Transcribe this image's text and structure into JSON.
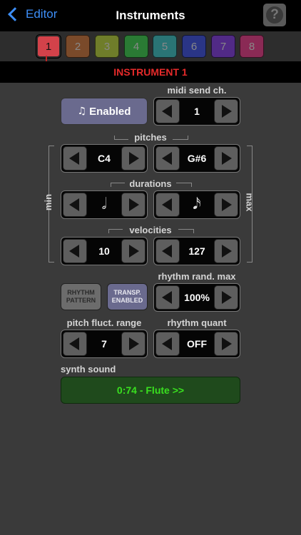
{
  "nav": {
    "back_label": "Editor",
    "title": "Instruments",
    "help_symbol": "?"
  },
  "tabs": [
    {
      "label": "1",
      "color": "#d3424a",
      "active": true
    },
    {
      "label": "2",
      "color": "#7a4a2a"
    },
    {
      "label": "3",
      "color": "#6f7d2a"
    },
    {
      "label": "4",
      "color": "#2a7a34"
    },
    {
      "label": "5",
      "color": "#2a7475"
    },
    {
      "label": "6",
      "color": "#2a3586"
    },
    {
      "label": "7",
      "color": "#512a86"
    },
    {
      "label": "8",
      "color": "#8a2a55"
    }
  ],
  "instrument_title": "INSTRUMENT 1",
  "enabled_button": {
    "icon": "♫",
    "label": "Enabled"
  },
  "midi": {
    "label": "midi send ch.",
    "value": "1"
  },
  "pitches": {
    "label": "pitches",
    "min": "C4",
    "max": "G#6"
  },
  "durations": {
    "label": "durations",
    "min_icon": "half-note-icon",
    "min": "𝅗𝅥",
    "max_icon": "sixteenth-note-icon",
    "max": "𝅘𝅥𝅯"
  },
  "velocities": {
    "label": "velocities",
    "min": "10",
    "max": "127"
  },
  "side_labels": {
    "min": "min",
    "max": "max"
  },
  "rhythm_pattern": {
    "line1": "RHYTHM",
    "line2": "PATTERN"
  },
  "transp_enabled": {
    "line1": "TRANSP.",
    "line2": "ENABLED"
  },
  "rhythm_rand": {
    "label": "rhythm rand. max",
    "value": "100%"
  },
  "pitch_fluct": {
    "label": "pitch fluct. range",
    "value": "7"
  },
  "rhythm_quant": {
    "label": "rhythm quant",
    "value": "OFF"
  },
  "synth": {
    "label": "synth sound",
    "value": "0:74 - Flute  >>"
  },
  "colors": {
    "accent_blue": "#3d8ef7",
    "instrument_red": "#e62a2a",
    "synth_green": "#39e01f"
  }
}
